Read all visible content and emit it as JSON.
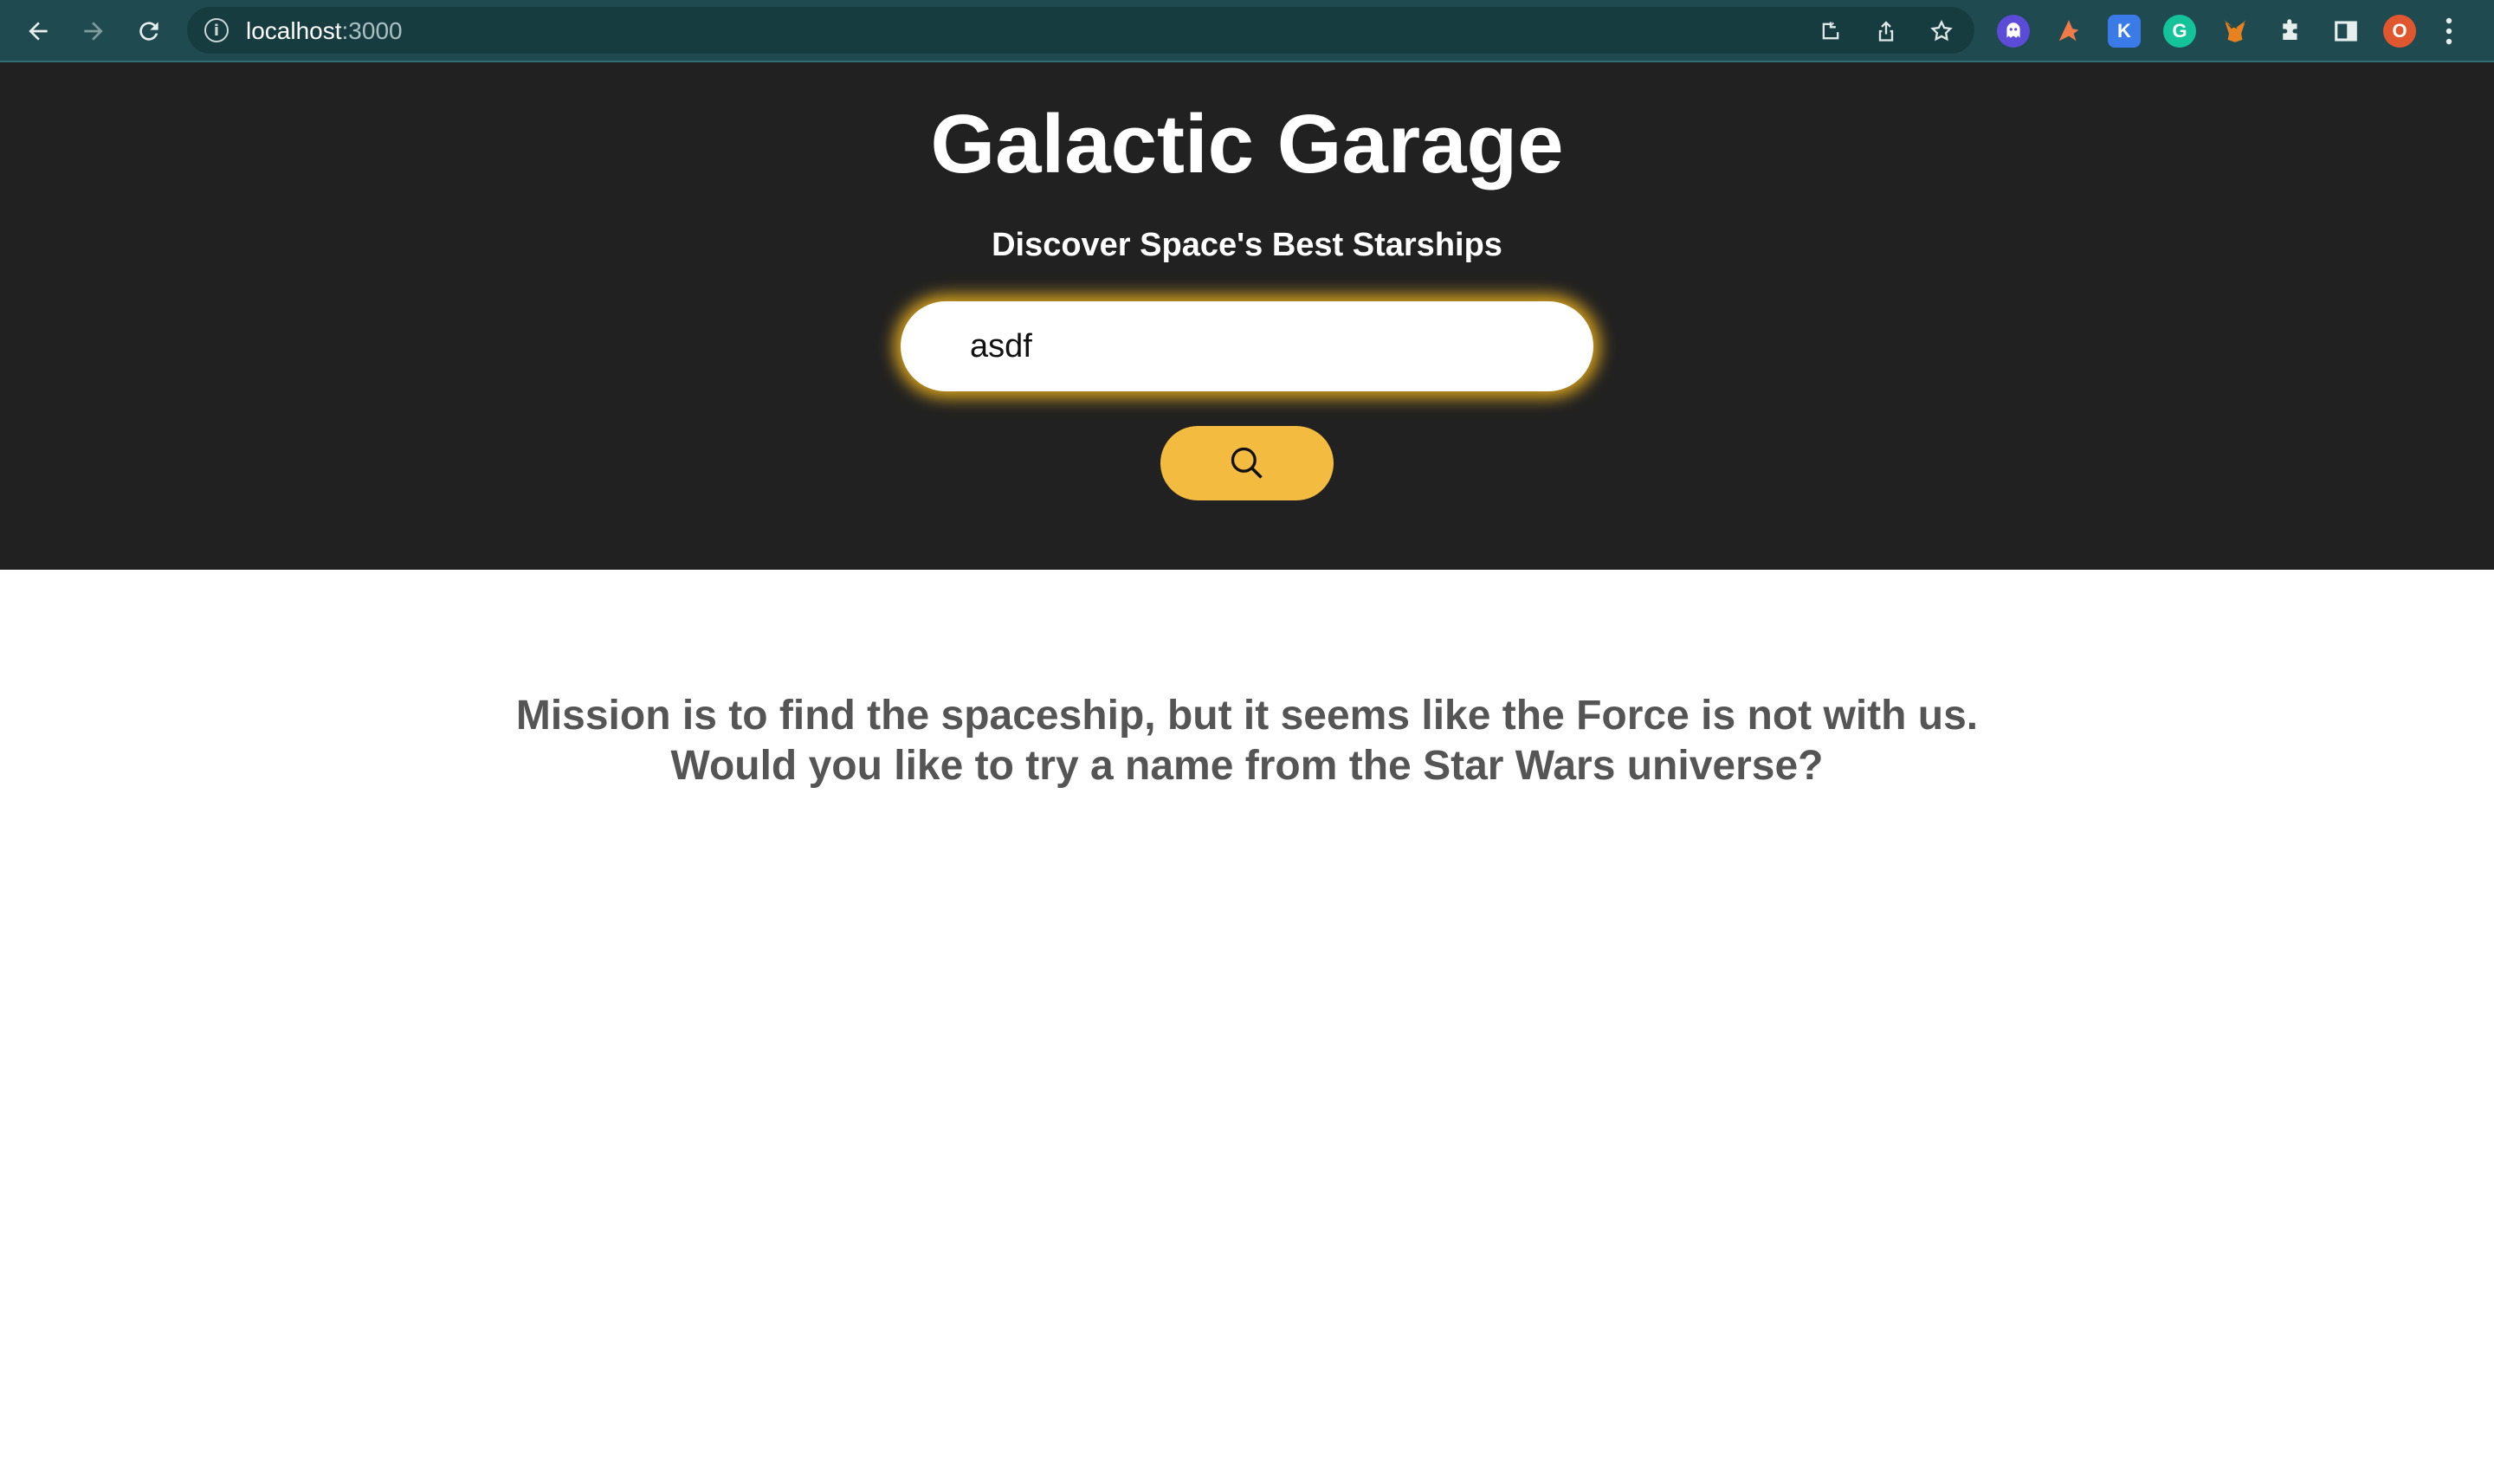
{
  "browser": {
    "url_host": "localhost",
    "url_port": ":3000",
    "profile_initial": "O",
    "extensions": [
      "ghost-extension-icon",
      "pen-extension-icon",
      "k-extension-icon",
      "grammarly-icon",
      "metamask-icon",
      "puzzle-icon"
    ],
    "k_label": "K",
    "g_label": "G"
  },
  "header": {
    "title": "Galactic Garage",
    "subtitle": "Discover Space's Best Starships"
  },
  "search": {
    "value": "asdf",
    "button_icon": "search-icon"
  },
  "message": {
    "line1": "Mission is to find the spaceship, but it seems like the Force is not with us.",
    "line2": "Would you like to try a name from the Star Wars universe?"
  },
  "colors": {
    "header_bg": "#212121",
    "accent": "#f3bb3f",
    "message_text": "#555555",
    "chrome_bg": "#1f4a4f"
  }
}
